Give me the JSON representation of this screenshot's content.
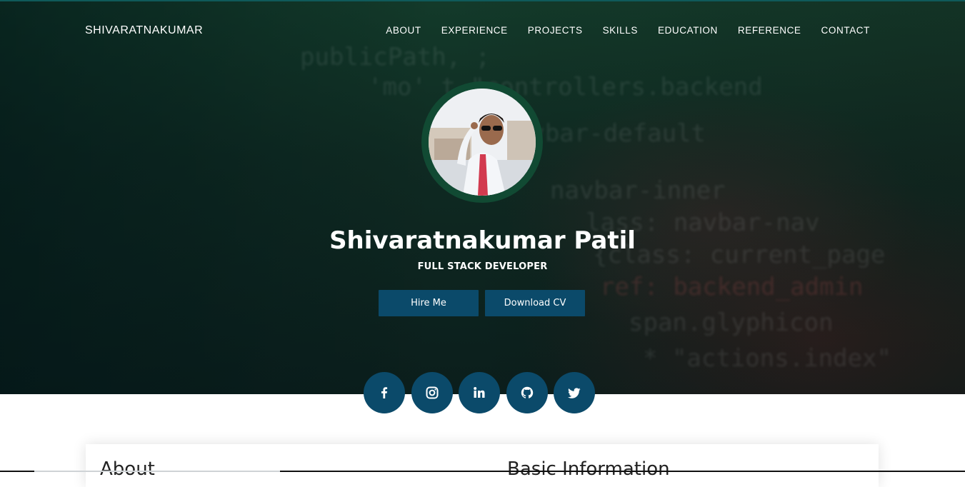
{
  "brand": "SHIVARATNAKUMAR",
  "nav": {
    "items": [
      "ABOUT",
      "EXPERIENCE",
      "PROJECTS",
      "SKILLS",
      "EDUCATION",
      "REFERENCE",
      "CONTACT"
    ]
  },
  "hero": {
    "name": "Shivaratnakumar Patil",
    "role": "FULL STACK DEVELOPER",
    "hire_label": "Hire Me",
    "cv_label": "Download CV"
  },
  "socials": [
    {
      "icon": "facebook-icon"
    },
    {
      "icon": "instagram-icon"
    },
    {
      "icon": "linkedin-icon"
    },
    {
      "icon": "github-icon"
    },
    {
      "icon": "twitter-icon"
    }
  ],
  "sections": {
    "about_title": "About",
    "basic_title": "Basic Information"
  },
  "colors": {
    "accent": "#0b4a6a",
    "avatar_ring": "#114a33",
    "hero_top": "#133a2a"
  }
}
